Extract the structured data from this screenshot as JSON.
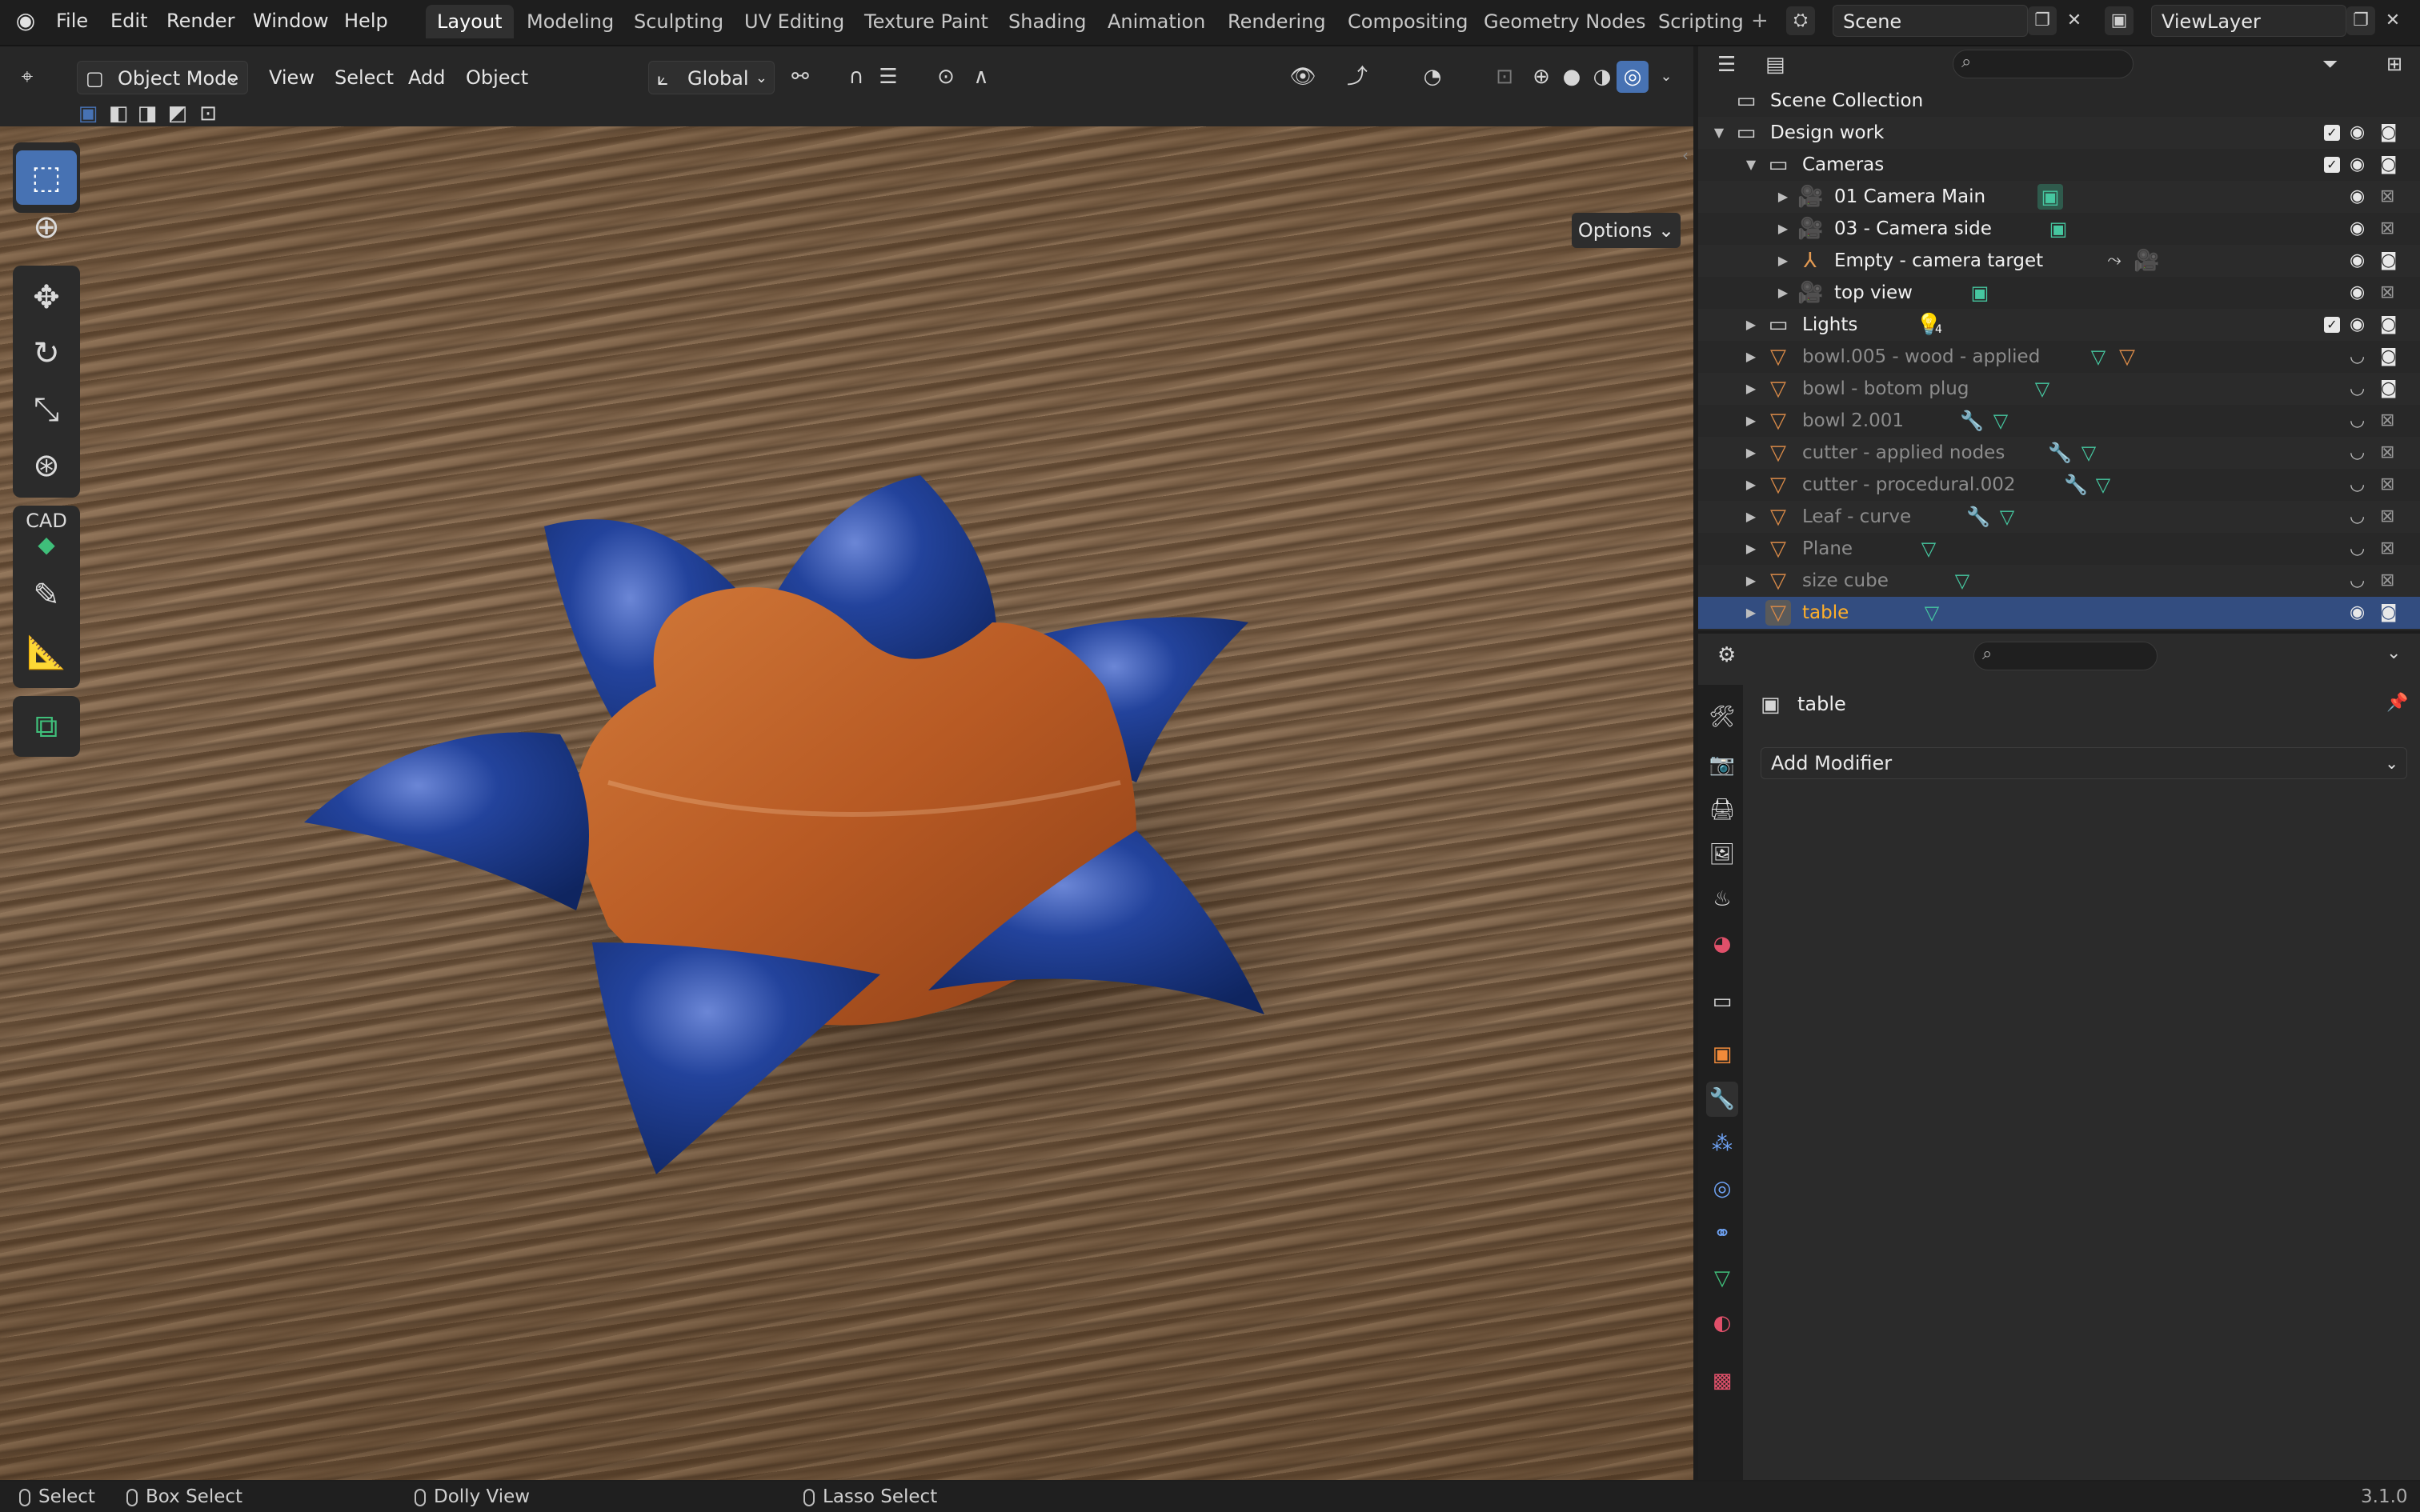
{
  "app": {
    "menus": [
      "File",
      "Edit",
      "Render",
      "Window",
      "Help"
    ],
    "workspaces": [
      "Layout",
      "Modeling",
      "Sculpting",
      "UV Editing",
      "Texture Paint",
      "Shading",
      "Animation",
      "Rendering",
      "Compositing",
      "Geometry Nodes",
      "Scripting"
    ],
    "active_workspace": "Layout",
    "scene": "Scene",
    "view_layer": "ViewLayer",
    "version": "3.1.0"
  },
  "viewport_header": {
    "mode": "Object Mode",
    "menus": [
      "View",
      "Select",
      "Add",
      "Object"
    ],
    "orientation": "Global",
    "options_label": "Options"
  },
  "toolbar": {
    "tools": [
      "select-box",
      "cursor",
      "move",
      "rotate",
      "scale",
      "transform",
      "cad",
      "annotate",
      "measure",
      "add-cube"
    ],
    "cad_label": "CAD"
  },
  "outliner": {
    "root": "Scene Collection",
    "rows": [
      {
        "label": "Design work"
      },
      {
        "label": "Cameras"
      },
      {
        "label": "01 Camera Main"
      },
      {
        "label": "03 - Camera side"
      },
      {
        "label": "Empty - camera target"
      },
      {
        "label": "top view"
      },
      {
        "label": "Lights",
        "badge": "4"
      },
      {
        "label": "bowl.005 - wood  - applied"
      },
      {
        "label": "bowl - botom plug"
      },
      {
        "label": "bowl 2.001"
      },
      {
        "label": "cutter - applied nodes"
      },
      {
        "label": "cutter - procedural.002"
      },
      {
        "label": "Leaf - curve"
      },
      {
        "label": "Plane"
      },
      {
        "label": "size cube"
      },
      {
        "label": "table"
      }
    ]
  },
  "properties": {
    "object_name": "table",
    "add_modifier_label": "Add Modifier"
  },
  "statusbar": {
    "select": "Select",
    "box_select": "Box Select",
    "dolly_view": "Dolly View",
    "lasso_select": "Lasso Select"
  },
  "colors": {
    "accent": "#4772b3",
    "selected_row": "#334d80",
    "active_object_text": "#ffaf29",
    "bowl_blue": "#1d3a8a",
    "bowl_wood": "#b85a24"
  }
}
